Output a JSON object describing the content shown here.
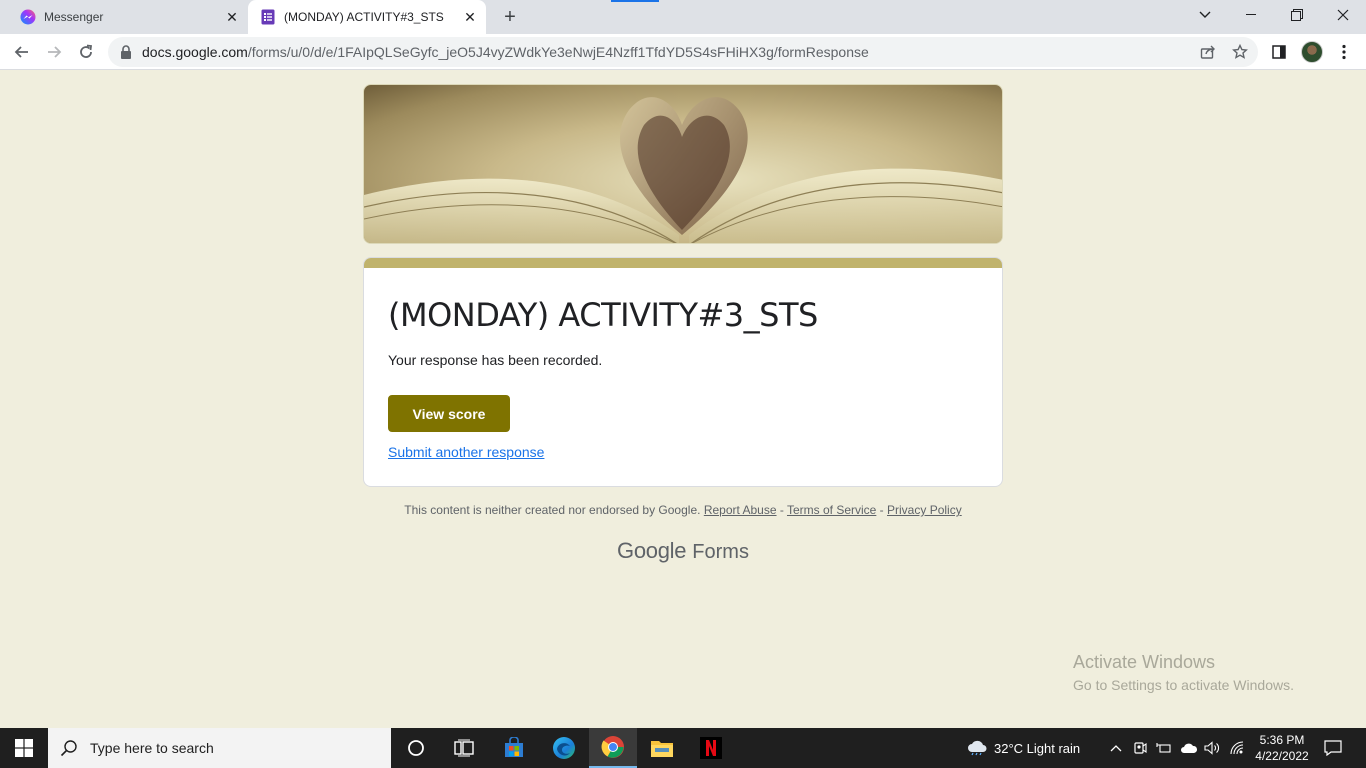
{
  "browser": {
    "tabs": [
      {
        "title": "Messenger",
        "active": false
      },
      {
        "title": "(MONDAY) ACTIVITY#3_STS",
        "active": true
      }
    ],
    "url_host": "docs.google.com",
    "url_path": "/forms/u/0/d/e/1FAIpQLSeGyfc_jeO5J4vyZWdkYe3eNwjE4Nzff1TfdYD5S4sFHiHX3g/formResponse"
  },
  "form": {
    "title": "(MONDAY) ACTIVITY#3_STS",
    "confirmation": "Your response has been recorded.",
    "view_score_label": "View score",
    "submit_another_label": "Submit another response",
    "accent_color": "#7f7300",
    "header_bar_color": "#c0b36c"
  },
  "footer": {
    "disclaimer": "This content is neither created nor endorsed by Google.",
    "report_abuse": "Report Abuse",
    "sep1": " - ",
    "terms": "Terms of Service",
    "sep2": " - ",
    "privacy": "Privacy Policy",
    "brand_google": "Google",
    "brand_forms": "Forms"
  },
  "watermark": {
    "line1": "Activate Windows",
    "line2": "Go to Settings to activate Windows."
  },
  "taskbar": {
    "search_placeholder": "Type here to search",
    "weather": "32°C  Light rain",
    "time": "5:36 PM",
    "date": "4/22/2022"
  }
}
